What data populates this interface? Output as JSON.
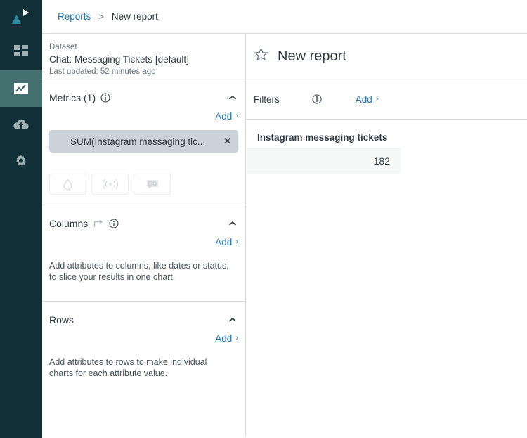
{
  "colors": {
    "rail_bg": "#123038",
    "rail_active": "#457070",
    "brand_teal": "#2e8a9e",
    "link_blue": "#1f73b7",
    "text_dark": "#2f3941",
    "text_muted": "#68737d",
    "chip_bg": "#ccd2d9",
    "cell_bg": "#f6f7f7",
    "border": "#d8dcde"
  },
  "rail": {
    "logo_name": "zendesk-explore-logo",
    "items": [
      {
        "name": "dashboards-icon",
        "label": "Dashboards",
        "active": false
      },
      {
        "name": "reports-chart-icon",
        "label": "Reports",
        "active": true
      },
      {
        "name": "cloud-upload-icon",
        "label": "Data sync",
        "active": false
      },
      {
        "name": "gear-icon",
        "label": "Settings",
        "active": false
      }
    ]
  },
  "breadcrumb": {
    "root_label": "Reports",
    "separator": ">",
    "current_label": "New report"
  },
  "dataset": {
    "label": "Dataset",
    "name": "Chat: Messaging Tickets [default]",
    "updated": "Last updated: 52 minutes ago"
  },
  "metrics": {
    "title": "Metrics (1)",
    "info_icon": "info-icon",
    "collapse_icon": "chevron-up-icon",
    "add_label": "Add",
    "add_carat": "›",
    "chips": [
      {
        "label": "SUM(Instagram messaging tic...",
        "remove_icon": "✕"
      }
    ],
    "quick_buttons": [
      {
        "name": "droplet-icon",
        "label": "Drill in"
      },
      {
        "name": "broadcast-icon",
        "label": "Live data"
      },
      {
        "name": "chat-bubble-icon",
        "label": "Comments"
      }
    ]
  },
  "columns": {
    "title": "Columns",
    "swap_icon": "swap-arrow-icon",
    "info_icon": "info-icon",
    "collapse_icon": "chevron-up-icon",
    "add_label": "Add",
    "add_carat": "›",
    "hint": "Add attributes to columns, like dates or status, to slice your results in one chart."
  },
  "rows": {
    "title": "Rows",
    "collapse_icon": "chevron-up-icon",
    "add_label": "Add",
    "add_carat": "›",
    "hint": "Add attributes to rows to make individual charts for each attribute value."
  },
  "report": {
    "favorite_icon": "star-outline-icon",
    "title": "New report"
  },
  "filters": {
    "label": "Filters",
    "info_icon": "info-icon",
    "add_label": "Add",
    "add_carat": "›"
  },
  "result": {
    "header": "Instagram messaging tickets",
    "value": "182"
  },
  "chart_data": {
    "type": "table",
    "title": "New report",
    "columns": [
      "Instagram messaging tickets"
    ],
    "rows": [
      [
        "182"
      ]
    ],
    "values": [
      182
    ],
    "categories": [
      "Instagram messaging tickets"
    ],
    "xlabel": "",
    "ylabel": "",
    "metric": "SUM(Instagram messaging tickets)",
    "dataset": "Chat: Messaging Tickets [default]"
  }
}
